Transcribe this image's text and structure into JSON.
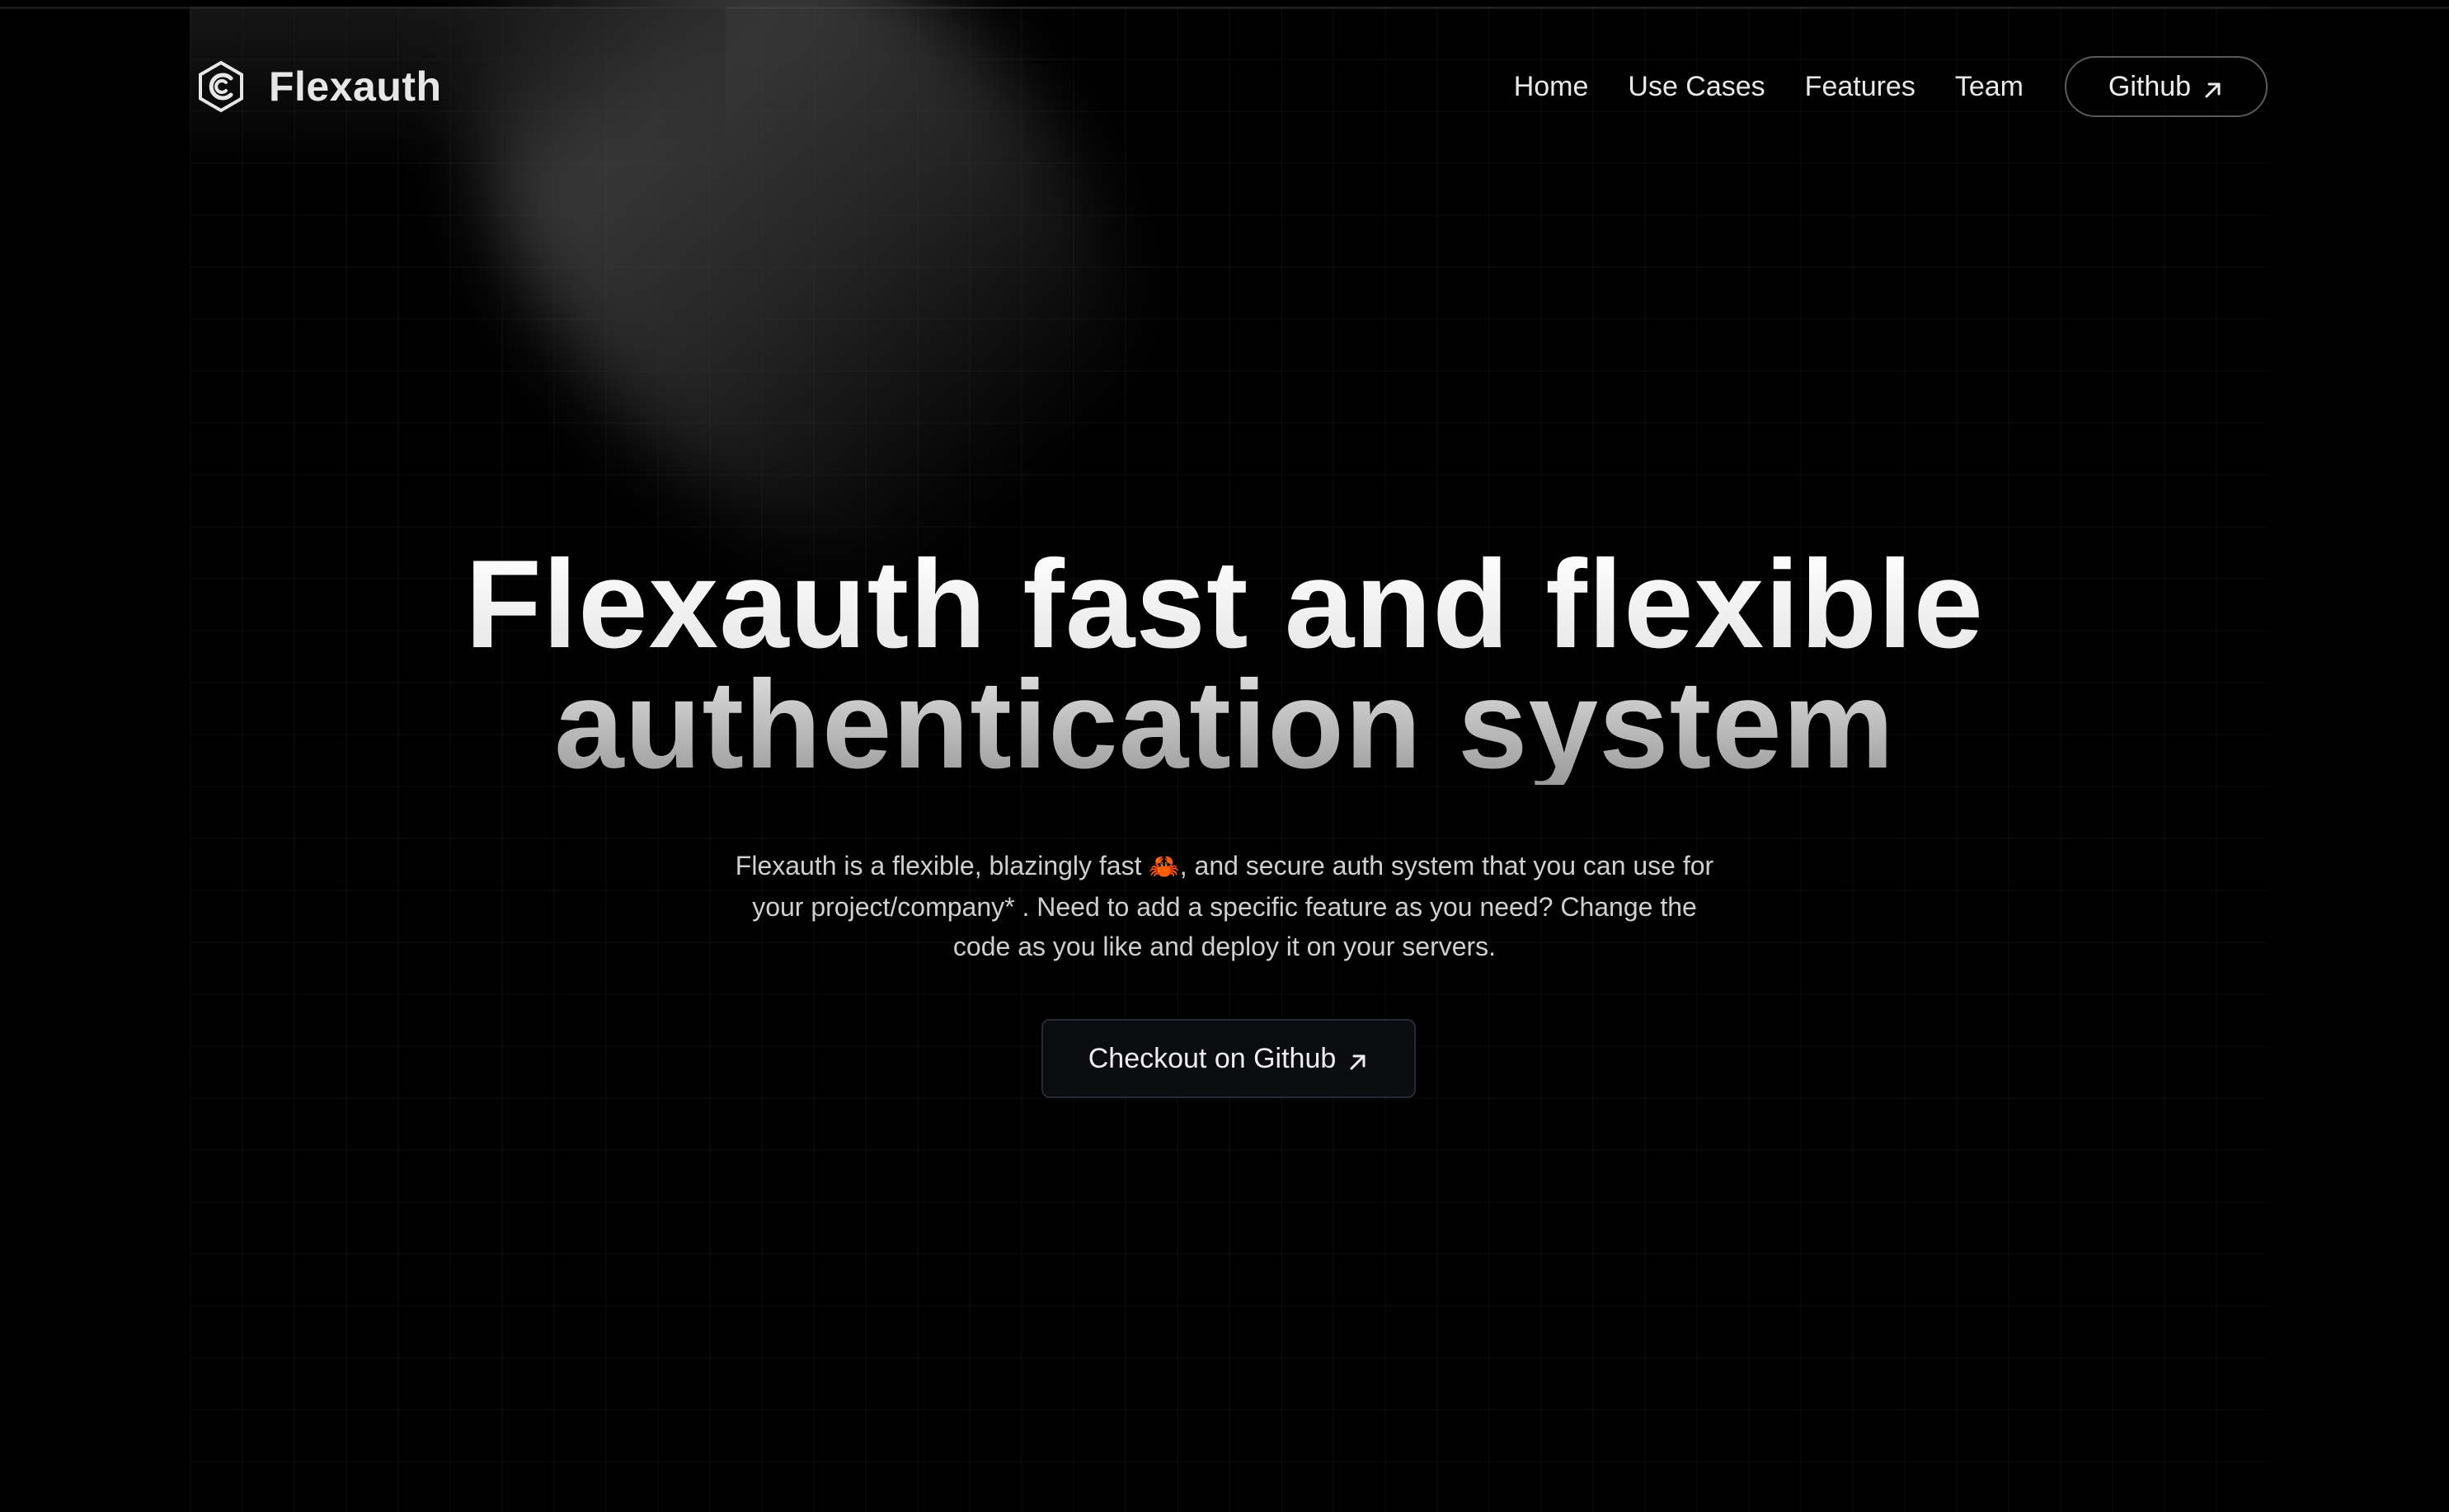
{
  "brand": {
    "name": "Flexauth",
    "logo_icon": "flexauth-logo-icon"
  },
  "nav": {
    "links": [
      {
        "label": "Home"
      },
      {
        "label": "Use Cases"
      },
      {
        "label": "Features"
      },
      {
        "label": "Team"
      }
    ],
    "github_label": "Github",
    "github_icon": "arrow-up-right-icon"
  },
  "hero": {
    "title_line1": "Flexauth fast and flexible",
    "title_line2": "authentication system",
    "desc_part1": "Flexauth is a flexible, blazingly fast ",
    "desc_emoji": "🦀",
    "desc_part2": ", and secure auth system that you can use for your project/company* . Need to add a specific feature as you need? Change the code as you like and deploy it on your servers.",
    "cta_label": "Checkout on Github",
    "cta_icon": "arrow-up-right-icon"
  },
  "colors": {
    "background": "#000000",
    "text": "#e8e8e8",
    "muted_text": "#cfcfcf",
    "button_border": "#5a5a5a",
    "cta_background": "#0b0c10"
  }
}
